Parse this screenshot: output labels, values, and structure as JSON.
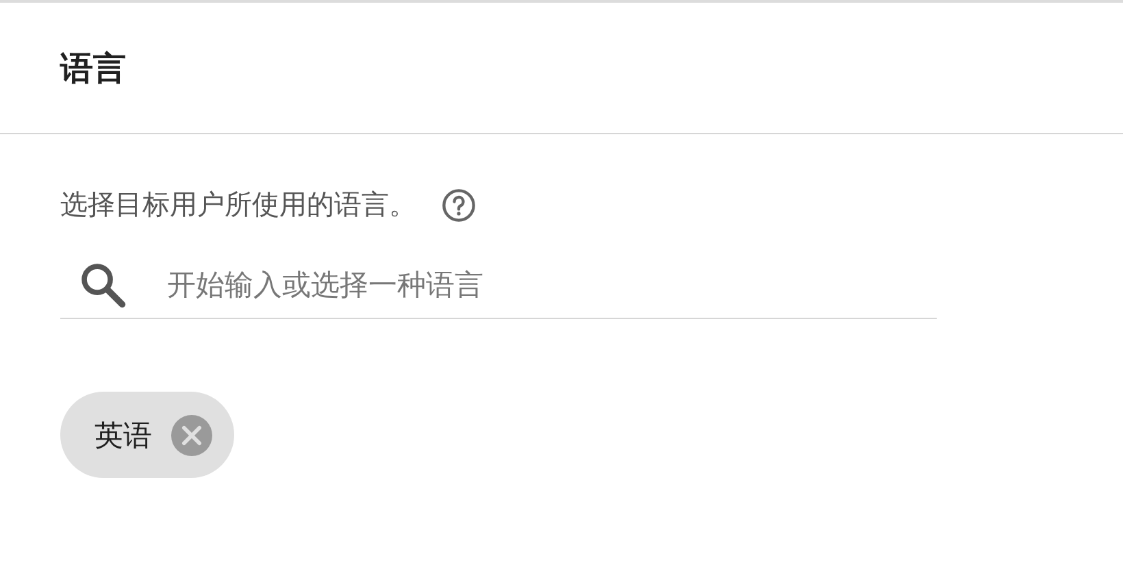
{
  "section": {
    "title": "语言"
  },
  "description": "选择目标用户所使用的语言。",
  "search": {
    "placeholder": "开始输入或选择一种语言"
  },
  "chips": [
    {
      "label": "英语"
    }
  ]
}
